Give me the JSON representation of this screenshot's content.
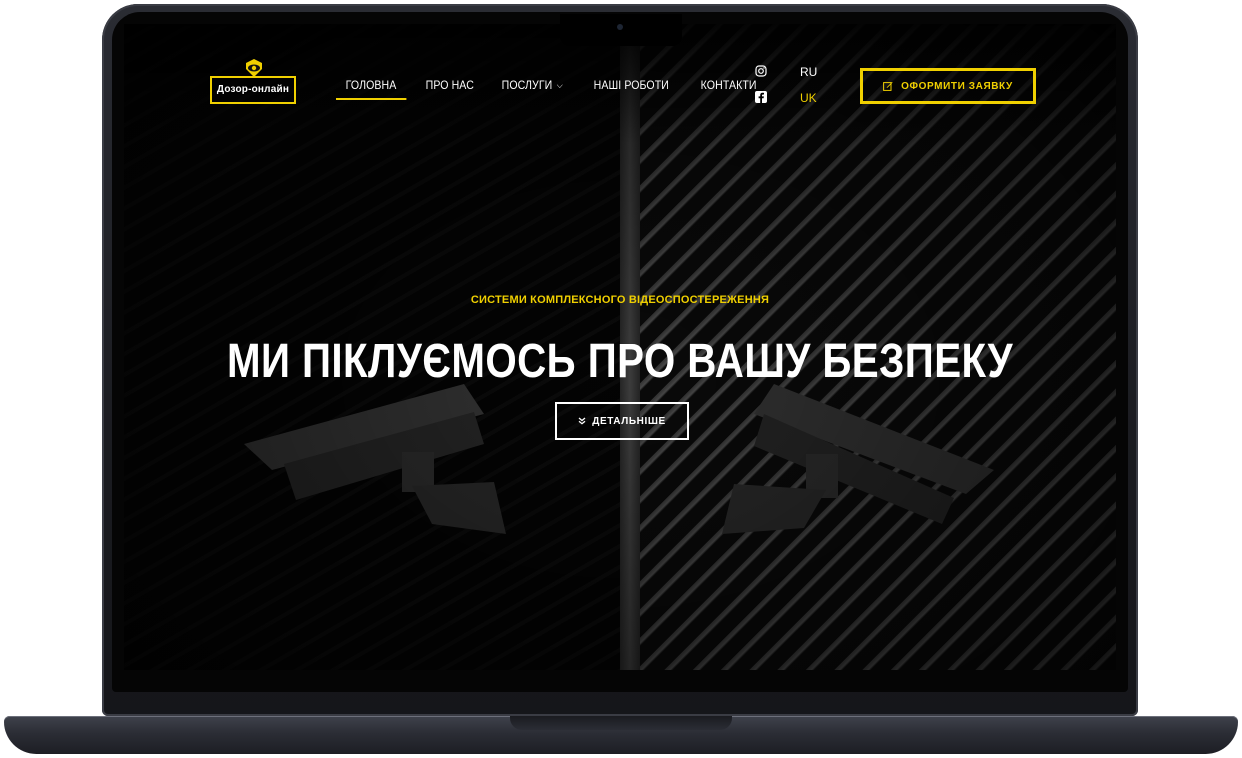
{
  "logo": {
    "text": "Дозор-онлайн",
    "icon": "eye-shield-icon"
  },
  "nav": {
    "items": [
      {
        "label": "ГОЛОВНА",
        "active": true
      },
      {
        "label": "ПРО НАС",
        "active": false
      },
      {
        "label": "ПОСЛУГИ",
        "active": false,
        "dropdown": true
      },
      {
        "label": "НАШІ РОБОТИ",
        "active": false
      },
      {
        "label": "КОНТАКТИ",
        "active": false
      }
    ]
  },
  "social": {
    "instagram_icon": "instagram-icon",
    "facebook_icon": "facebook-icon"
  },
  "lang": {
    "ru": "RU",
    "uk": "UK",
    "active": "UK"
  },
  "cta": {
    "label": "ОФОРМИТИ ЗАЯВКУ",
    "icon": "edit-icon"
  },
  "hero": {
    "kicker": "СИСТЕМИ КОМПЛЕКСНОГО ВІДЕОСПОСТЕРЕЖЕННЯ",
    "title": "МИ ПІКЛУЄМОСЬ ПРО ВАШУ БЕЗПЕКУ",
    "button_label": "ДЕТАЛЬНІШЕ",
    "button_icon": "double-chevron-down-icon"
  },
  "colors": {
    "accent": "#f0d000",
    "background": "#050505",
    "text": "#ffffff"
  }
}
